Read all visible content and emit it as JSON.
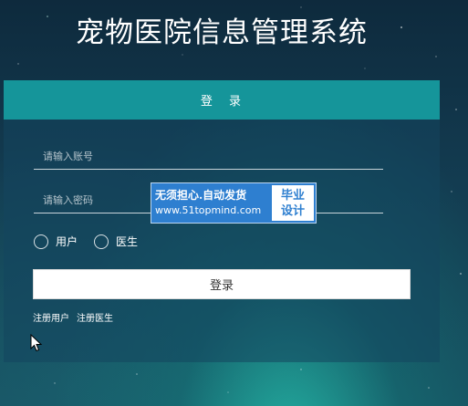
{
  "page": {
    "title": "宠物医院信息管理系统"
  },
  "login_panel": {
    "header": "登 录",
    "username_placeholder": "请输入账号",
    "password_placeholder": "请输入密码",
    "roles": [
      {
        "label": "用户",
        "selected": false
      },
      {
        "label": "医生",
        "selected": false
      }
    ],
    "submit_label": "登录",
    "register_user_link": "注册用户",
    "register_doctor_link": "注册医生"
  },
  "watermark": {
    "line1": "无须担心.自动发货",
    "line2": "www.51topmind.com",
    "badge_line1": "毕业",
    "badge_line2": "设计"
  },
  "colors": {
    "panel_header": "#15959a",
    "watermark_bg": "#2e7fd0",
    "button_bg": "#ffffff"
  },
  "icons": {
    "cursor": "mouse-pointer-icon"
  }
}
